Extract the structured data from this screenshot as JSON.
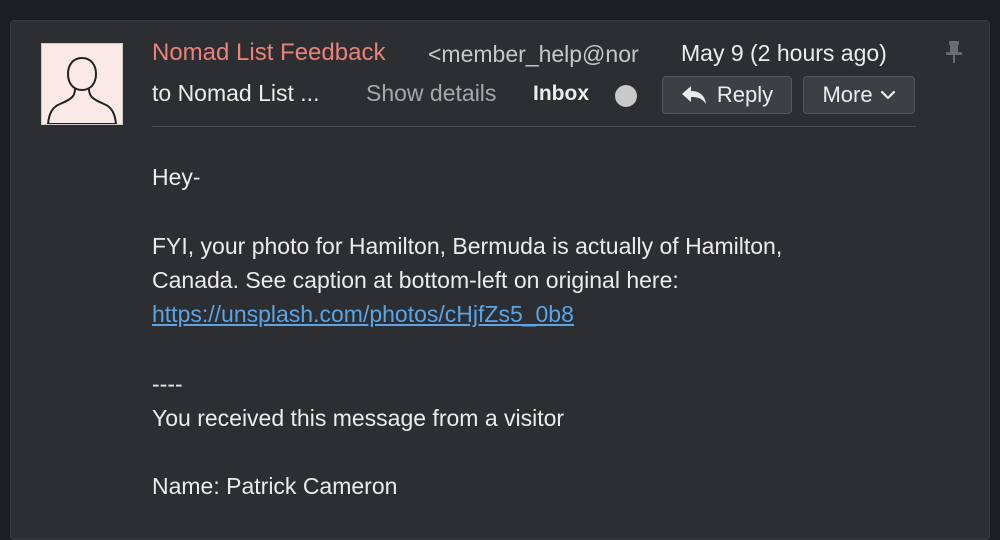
{
  "sender": {
    "name": "Nomad List Feedback",
    "email": "<member_help@nor",
    "date": "May 9 (2 hours ago)"
  },
  "recipient": "to Nomad List ...",
  "show_details": "Show details",
  "folder": "Inbox",
  "buttons": {
    "reply": "Reply",
    "more": "More"
  },
  "body": {
    "greeting": "Hey-",
    "line1": "FYI, your photo for Hamilton, Bermuda is actually of Hamilton,",
    "line2": "Canada. See caption at bottom-left on original here:",
    "link": "https://unsplash.com/photos/cHjfZs5_0b8",
    "separator": "----",
    "notice": "You received this message from a visitor",
    "name_line": "Name: Patrick Cameron"
  },
  "icons": {
    "avatar": "person-silhouette-icon",
    "pin": "pin-icon",
    "reply": "reply-arrow-icon",
    "more": "chevron-down-icon"
  },
  "colors": {
    "sender_name": "#e8837c",
    "link": "#5ba4e5",
    "background": "#1d1e21",
    "card": "#2d2e32"
  }
}
